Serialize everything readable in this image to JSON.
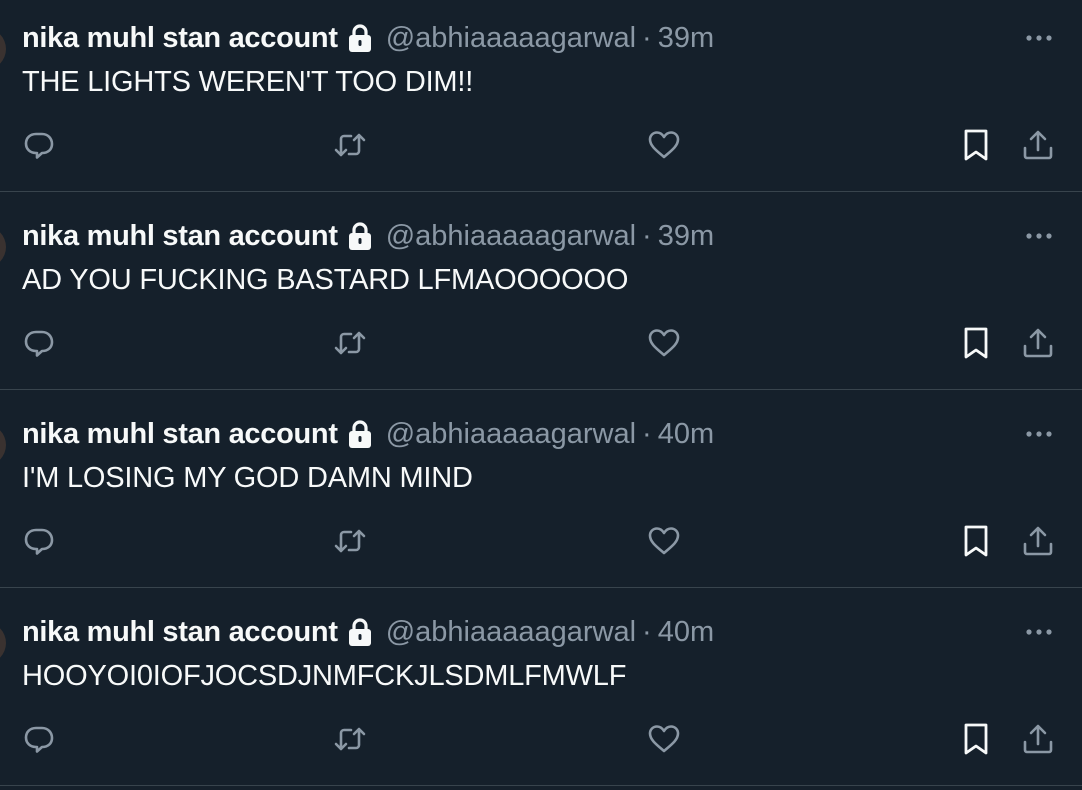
{
  "colors": {
    "background": "#15202b",
    "text_primary": "#f7f9f9",
    "text_secondary": "#8b98a5",
    "divider": "#38444d"
  },
  "tweets": [
    {
      "name": "nika muhl stan account",
      "handle": "@abhiaaaaagarwal",
      "separator": "·",
      "time": "39m",
      "text": "THE LIGHTS WEREN'T TOO DIM!!",
      "icons": [
        "lock-icon",
        "more-icon",
        "reply-icon",
        "retweet-icon",
        "like-icon",
        "bookmark-icon",
        "share-icon"
      ]
    },
    {
      "name": "nika muhl stan account",
      "handle": "@abhiaaaaagarwal",
      "separator": "·",
      "time": "39m",
      "text": "AD YOU FUCKING BASTARD LFMAOOOOOO",
      "icons": [
        "lock-icon",
        "more-icon",
        "reply-icon",
        "retweet-icon",
        "like-icon",
        "bookmark-icon",
        "share-icon"
      ]
    },
    {
      "name": "nika muhl stan account",
      "handle": "@abhiaaaaagarwal",
      "separator": "·",
      "time": "40m",
      "text": "I'M LOSING MY GOD DAMN MIND",
      "icons": [
        "lock-icon",
        "more-icon",
        "reply-icon",
        "retweet-icon",
        "like-icon",
        "bookmark-icon",
        "share-icon"
      ]
    },
    {
      "name": "nika muhl stan account",
      "handle": "@abhiaaaaagarwal",
      "separator": "·",
      "time": "40m",
      "text": "HOOYOI0IOFJOCSDJNMFCKJLSDMLFMWLF",
      "icons": [
        "lock-icon",
        "more-icon",
        "reply-icon",
        "retweet-icon",
        "like-icon",
        "bookmark-icon",
        "share-icon"
      ]
    }
  ]
}
